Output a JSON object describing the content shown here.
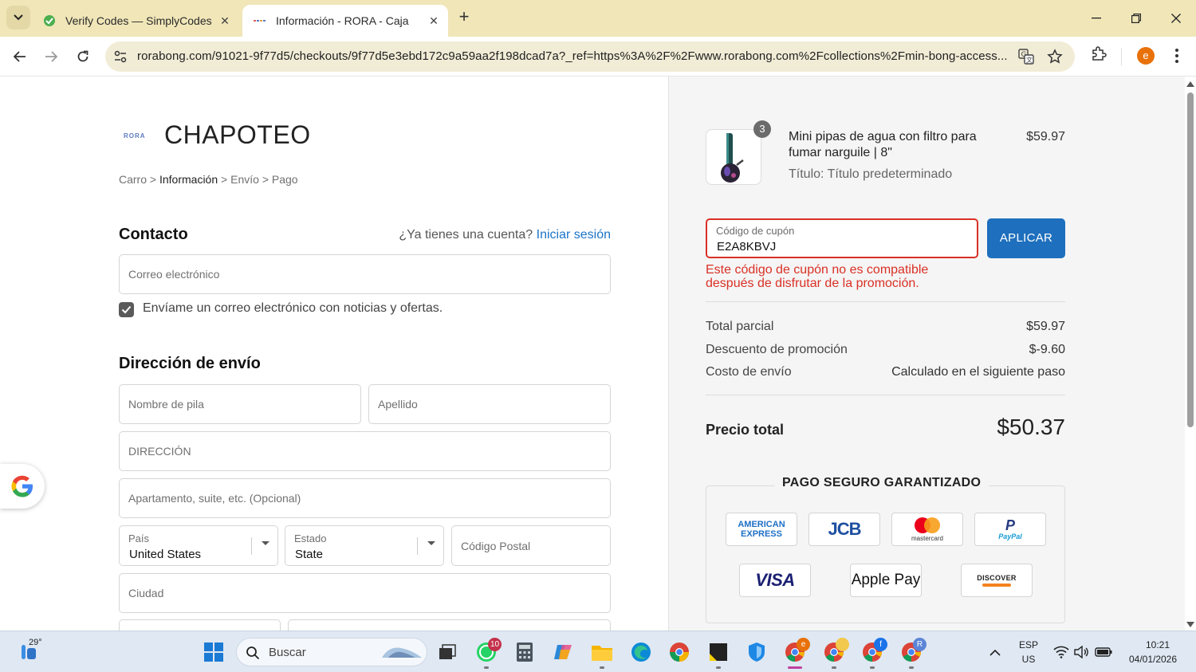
{
  "browser": {
    "tabs": [
      {
        "title": "Verify Codes — SimplyCodes",
        "active": false
      },
      {
        "title": "Información - RORA - Caja",
        "active": true
      }
    ],
    "url": "rorabong.com/91021-9f77d5/checkouts/9f77d5e3ebd172c9a59aa2f198dcad7a?_ref=https%3A%2F%2Fwww.rorabong.com%2Fcollections%2Fmin-bong-access...",
    "profile_initial": "e"
  },
  "store": {
    "logo_text": "RORA",
    "name": "CHAPOTEO"
  },
  "breadcrumb": {
    "items": [
      "Carro",
      "Información",
      "Envío",
      "Pago"
    ],
    "separator": ">"
  },
  "contact": {
    "title": "Contacto",
    "account_prompt": "¿Ya tienes una cuenta?",
    "login_link": "Iniciar sesión",
    "email_placeholder": "Correo electrónico",
    "newsletter_label": "Envíame un correo electrónico con noticias y ofertas.",
    "newsletter_checked": true
  },
  "shipping": {
    "title": "Dirección de envío",
    "first_name_placeholder": "Nombre de pila",
    "last_name_placeholder": "Apellido",
    "address_placeholder": "DIRECCIÓN",
    "apartment_placeholder": "Apartamento, suite, etc. (Opcional)",
    "country_label": "País",
    "country_value": "United States",
    "state_label": "Estado",
    "state_value": "State",
    "zip_placeholder": "Código Postal",
    "city_placeholder": "Ciudad"
  },
  "order": {
    "product": {
      "name": "Mini pipas de agua con filtro para fumar narguile | 8\"",
      "variant": "Título: Título predeterminado",
      "price": "$59.97",
      "quantity": "3"
    },
    "coupon": {
      "label": "Código de cupón",
      "value": "E2A8KBVJ",
      "apply_label": "APLICAR",
      "error": "Este código de cupón no es compatible después de disfrutar de la promoción."
    },
    "summary": [
      {
        "label": "Total parcial",
        "value": "$59.97"
      },
      {
        "label": "Descuento de promoción",
        "value": "$-9.60"
      },
      {
        "label": "Costo de envío",
        "value": "Calculado en el siguiente paso"
      }
    ],
    "total_label": "Precio total",
    "total_value": "$50.37",
    "secure_title": "PAGO SEGURO GARANTIZADO",
    "payment_methods": [
      "AMERICAN EXPRESS",
      "JCB",
      "mastercard",
      "PayPal",
      "VISA",
      "Apple Pay",
      "DISCOVER"
    ]
  },
  "taskbar": {
    "temperature": "29°",
    "search_placeholder": "Buscar",
    "whatsapp_badge": "10",
    "lang_primary": "ESP",
    "lang_secondary": "US",
    "time": "10:21",
    "date": "04/01/2026",
    "chrome_profiles": [
      "e",
      "",
      "f",
      "R"
    ]
  }
}
